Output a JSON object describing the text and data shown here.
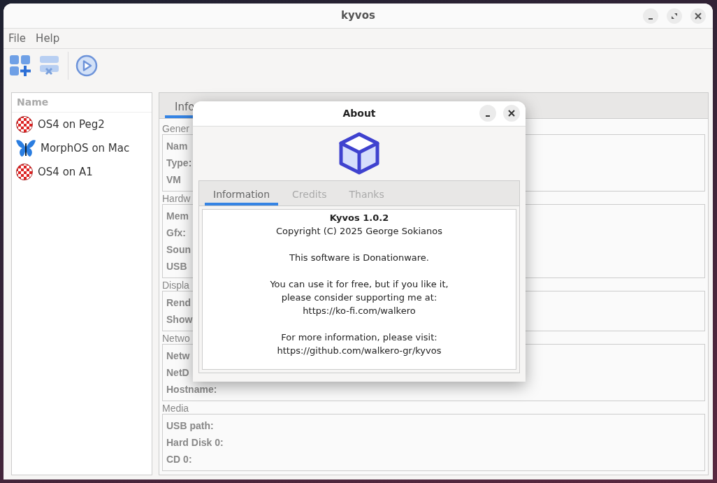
{
  "window": {
    "title": "kyvos"
  },
  "menu": [
    "File",
    "Help"
  ],
  "sidebar": {
    "header": "Name",
    "items": [
      {
        "label": "OS4 on Peg2",
        "kind": "ball"
      },
      {
        "label": "MorphOS on Mac",
        "kind": "butterfly"
      },
      {
        "label": "OS4 on A1",
        "kind": "ball"
      }
    ]
  },
  "tabs": [
    {
      "label": "Info",
      "selected": true
    }
  ],
  "groups": [
    {
      "title": "Gener",
      "fields": [
        "Nam",
        "Type:",
        "VM"
      ]
    },
    {
      "title": "Hardw",
      "fields": [
        "Mem",
        "Gfx:",
        "Soun",
        "USB"
      ]
    },
    {
      "title": "Displa",
      "fields": [
        "Rend",
        "Show"
      ]
    },
    {
      "title": "Netwo",
      "fields": [
        "Netw",
        "NetD",
        "Hostname:"
      ]
    },
    {
      "title": "Media",
      "fields": [
        "USB path:",
        "Hard Disk 0:",
        "CD 0:"
      ]
    }
  ],
  "dialog": {
    "title": "About",
    "tabs": [
      {
        "label": "Information",
        "selected": true
      },
      {
        "label": "Credits",
        "selected": false
      },
      {
        "label": "Thanks",
        "selected": false
      }
    ],
    "heading": "Kyvos 1.0.2",
    "paragraphs": [
      [
        "Copyright (C) 2025 George Sokianos"
      ],
      [
        "This software is Donationware."
      ],
      [
        "You can use it for free, but if you like it,",
        "please consider supporting me at:",
        "https://ko-fi.com/walkero"
      ],
      [
        "For more information, please visit:",
        "https://github.com/walkero-gr/kyvos"
      ]
    ]
  }
}
